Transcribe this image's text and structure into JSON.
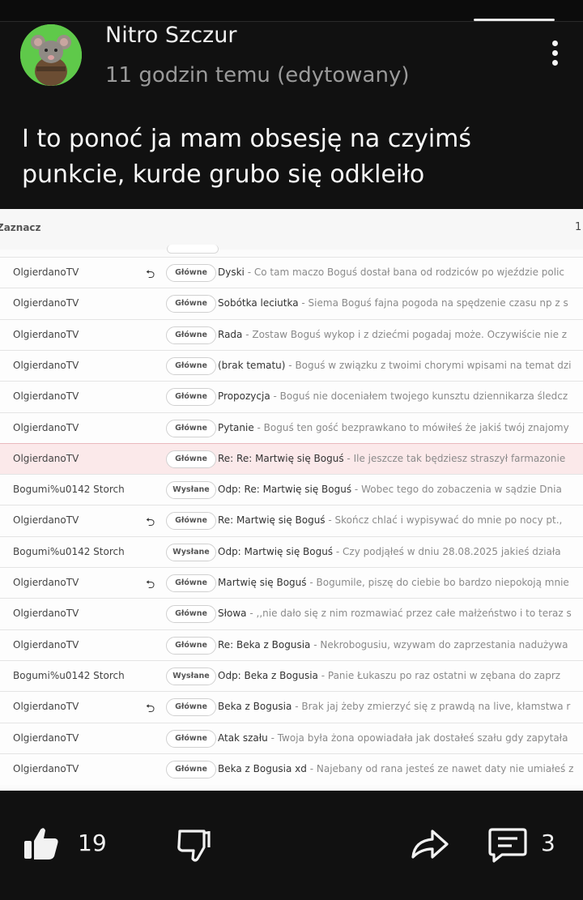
{
  "post": {
    "author": "Nitro Szczur",
    "meta": "11 godzin temu (edytowany)",
    "text": "I to ponoć ja mam obsesję na czyimś punkcie, kurde grubo się odkleiło"
  },
  "screenshot": {
    "header_label": "Zaznacz",
    "header_count": "1",
    "rows": [
      {
        "sender": "OlgierdanoTV",
        "replied": true,
        "tag": "Główne",
        "subject": "Dyski",
        "preview": " - Co tam maczo Boguś dostał bana od rodziców po wjeździe polic",
        "highlight": false
      },
      {
        "sender": "OlgierdanoTV",
        "replied": false,
        "tag": "Główne",
        "subject": "Sobótka leciutka",
        "preview": " - Siema Boguś fajna pogoda na spędzenie czasu np z s",
        "highlight": false
      },
      {
        "sender": "OlgierdanoTV",
        "replied": false,
        "tag": "Główne",
        "subject": "Rada",
        "preview": " - Zostaw Boguś wykop i z dziećmi pogadaj może. Oczywiście nie z",
        "highlight": false
      },
      {
        "sender": "OlgierdanoTV",
        "replied": false,
        "tag": "Główne",
        "subject": "(brak tematu)",
        "preview": " - Boguś w związku z twoimi chorymi wpisami na temat dzi",
        "highlight": false
      },
      {
        "sender": "OlgierdanoTV",
        "replied": false,
        "tag": "Główne",
        "subject": "Propozycja",
        "preview": " - Boguś nie doceniałem twojego kunsztu dziennikarza śledcz",
        "highlight": false
      },
      {
        "sender": "OlgierdanoTV",
        "replied": false,
        "tag": "Główne",
        "subject": "Pytanie",
        "preview": " - Boguś ten gość bezprawkano to mówiłeś że jakiś twój znajomy",
        "highlight": false
      },
      {
        "sender": "OlgierdanoTV",
        "replied": false,
        "tag": "Główne",
        "subject": "Re: Re: Martwię się Boguś",
        "preview": " - Ile jeszcze tak będziesz straszył farmazonie",
        "highlight": true
      },
      {
        "sender": "Bogumi%u0142 Storch",
        "replied": false,
        "tag": "Wysłane",
        "subject": "Odp: Re: Martwię się Boguś",
        "preview": " - Wobec tego do zobaczenia w sądzie Dnia",
        "highlight": false
      },
      {
        "sender": "OlgierdanoTV",
        "replied": true,
        "tag": "Główne",
        "subject": "Re: Martwię się Boguś",
        "preview": " - Skończ chlać i wypisywać do mnie po nocy pt.,",
        "highlight": false
      },
      {
        "sender": "Bogumi%u0142 Storch",
        "replied": false,
        "tag": "Wysłane",
        "subject": "Odp: Martwię się Boguś",
        "preview": " - Czy podjąłeś w dniu 28.08.2025 jakieś działa",
        "highlight": false
      },
      {
        "sender": "OlgierdanoTV",
        "replied": true,
        "tag": "Główne",
        "subject": "Martwię się Boguś",
        "preview": " - Bogumile, piszę do ciebie bo bardzo niepokoją mnie",
        "highlight": false
      },
      {
        "sender": "OlgierdanoTV",
        "replied": false,
        "tag": "Główne",
        "subject": "Słowa",
        "preview": " - ,,nie dało się z nim rozmawiać przez całe małżeństwo i to teraz s",
        "highlight": false
      },
      {
        "sender": "OlgierdanoTV",
        "replied": false,
        "tag": "Główne",
        "subject": "Re: Beka z Bogusia",
        "preview": " - Nekrobogusiu, wzywam do zaprzestania nadużywa",
        "highlight": false
      },
      {
        "sender": "Bogumi%u0142 Storch",
        "replied": false,
        "tag": "Wysłane",
        "subject": "Odp: Beka z Bogusia",
        "preview": " - Panie Łukaszu po raz ostatni w zębana do zaprz",
        "highlight": false
      },
      {
        "sender": "OlgierdanoTV",
        "replied": true,
        "tag": "Główne",
        "subject": "Beka z Bogusia",
        "preview": " - Brak jaj żeby zmierzyć się z prawdą na live, kłamstwa r",
        "highlight": false
      },
      {
        "sender": "OlgierdanoTV",
        "replied": false,
        "tag": "Główne",
        "subject": "Atak szału",
        "preview": " - Twoja była żona opowiadała jak dostałeś szału gdy zapytała",
        "highlight": false
      },
      {
        "sender": "OlgierdanoTV",
        "replied": false,
        "tag": "Główne",
        "subject": "Beka z Bogusia xd",
        "preview": " - Najebany od rana jesteś ze nawet daty nie umiałeś z",
        "highlight": false
      }
    ]
  },
  "actions": {
    "likes": "19",
    "comments": "3",
    "like_icon": "thumbs-up-icon",
    "dislike_icon": "thumbs-down-icon",
    "share_icon": "share-icon",
    "comment_icon": "comment-icon"
  }
}
